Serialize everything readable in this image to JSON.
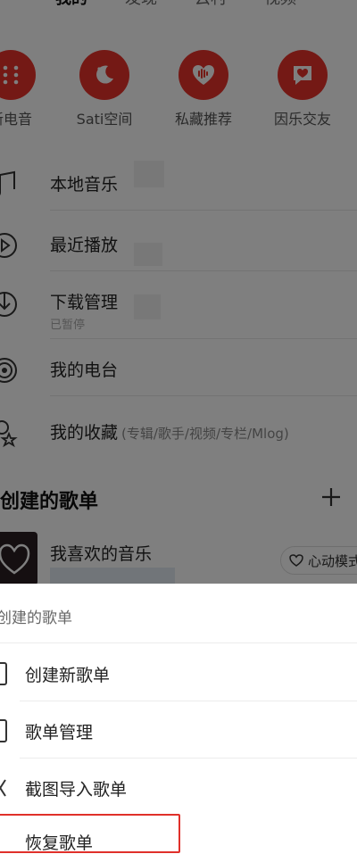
{
  "top_tabs": [
    "我的",
    "发现",
    "云村",
    "视频"
  ],
  "quick_entries": [
    {
      "label": "新电音",
      "icon": "grid-dots-icon"
    },
    {
      "label": "Sati空间",
      "icon": "moon-icon"
    },
    {
      "label": "私藏推荐",
      "icon": "sound-wave-heart-icon"
    },
    {
      "label": "因乐交友",
      "icon": "chat-heart-icon"
    }
  ],
  "menu": {
    "local_music": "本地音乐",
    "recent_play": "最近播放",
    "download": "下载管理",
    "download_status": "已暂停",
    "radio": "我的电台",
    "favorites": "我的收藏",
    "favorites_note": "(专辑/歌手/视频/专栏/Mlog)"
  },
  "playlists_section": {
    "title": "创建的歌单",
    "liked_music": "我喜欢的音乐",
    "heart_mode": "心动模式"
  },
  "sheet": {
    "title": "创建的歌单",
    "items": [
      "创建新歌单",
      "歌单管理",
      "截图导入歌单"
    ],
    "partial_item": "恢复歌单"
  },
  "colors": {
    "accent": "#e8332b",
    "highlight_border": "#e0302a",
    "overlay": "rgba(0,0,0,0.5)"
  }
}
